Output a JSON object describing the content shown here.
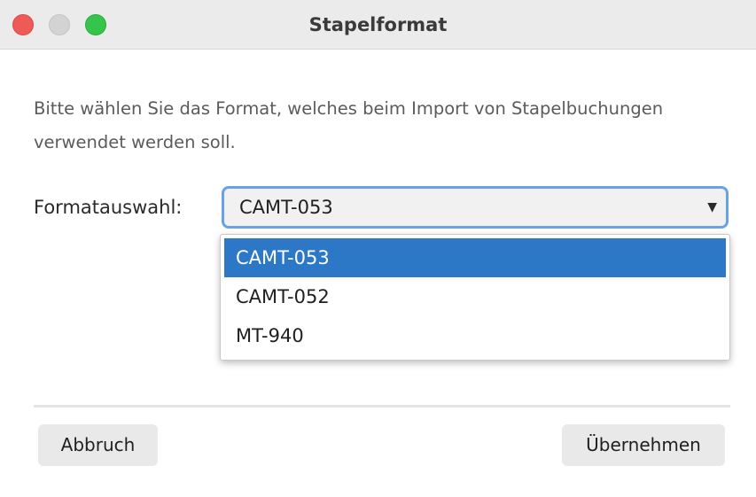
{
  "window": {
    "title": "Stapelformat"
  },
  "dialog": {
    "description": "Bitte wählen Sie das Format, welches beim Import von Stapelbuchungen verwendet werden soll.",
    "format_label": "Formatauswahl:",
    "select": {
      "value": "CAMT-053",
      "arrow": "▼",
      "options": [
        "CAMT-053",
        "CAMT-052",
        "MT-940"
      ],
      "highlighted_index": 0
    },
    "buttons": {
      "cancel": "Abbruch",
      "apply": "Übernehmen"
    }
  },
  "colors": {
    "accent": "#2c78c7",
    "focus_ring": "#6aa2e6",
    "close": "#ee5b56",
    "minimize": "#d3d3d3",
    "maximize": "#36c54b"
  }
}
